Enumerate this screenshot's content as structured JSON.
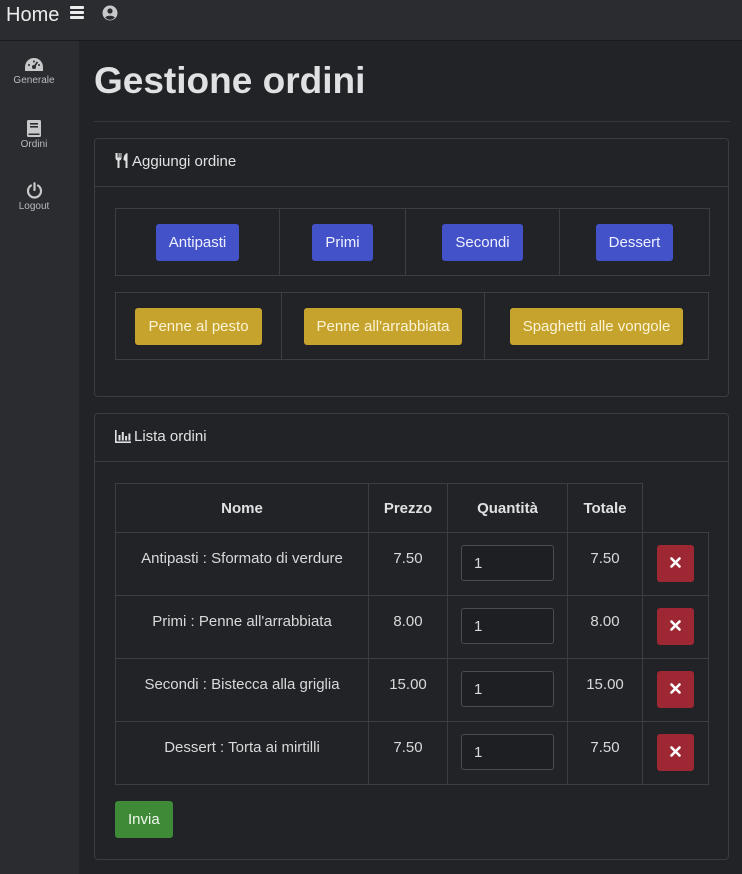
{
  "topbar": {
    "brand": "Home",
    "menu_icon": "hamburger-icon",
    "user_icon": "user-circle-icon"
  },
  "sidebar": {
    "items": [
      {
        "label": "Generale",
        "icon": "dashboard-icon"
      },
      {
        "label": "Ordini",
        "icon": "book-icon"
      },
      {
        "label": "Logout",
        "icon": "power-icon"
      }
    ]
  },
  "page": {
    "title": "Gestione ordini"
  },
  "add_order": {
    "header": "Aggiungi ordine",
    "header_icon": "utensils-icon",
    "categories": [
      "Antipasti",
      "Primi",
      "Secondi",
      "Dessert"
    ],
    "dishes": [
      "Penne al pesto",
      "Penne all'arrabbiata",
      "Spaghetti alle vongole"
    ]
  },
  "order_list": {
    "header": "Lista ordini",
    "header_icon": "bar-chart-icon",
    "columns": [
      "Nome",
      "Prezzo",
      "Quantità",
      "Totale",
      ""
    ],
    "rows": [
      {
        "name": "Antipasti : Sformato di verdure",
        "price": "7.50",
        "qty": "1",
        "total": "7.50"
      },
      {
        "name": "Primi : Penne all'arrabbiata",
        "price": "8.00",
        "qty": "1",
        "total": "8.00"
      },
      {
        "name": "Secondi : Bistecca alla griglia",
        "price": "15.00",
        "qty": "1",
        "total": "15.00"
      },
      {
        "name": "Dessert : Torta ai mirtilli",
        "price": "7.50",
        "qty": "1",
        "total": "7.50"
      }
    ],
    "submit_label": "Invia"
  },
  "colors": {
    "background": "#212326",
    "sidebar": "#2b2c2f",
    "category_button": "#4452c9",
    "dish_button": "#c6a32c",
    "delete_button": "#9d2733",
    "submit_button": "#3f8a37"
  }
}
